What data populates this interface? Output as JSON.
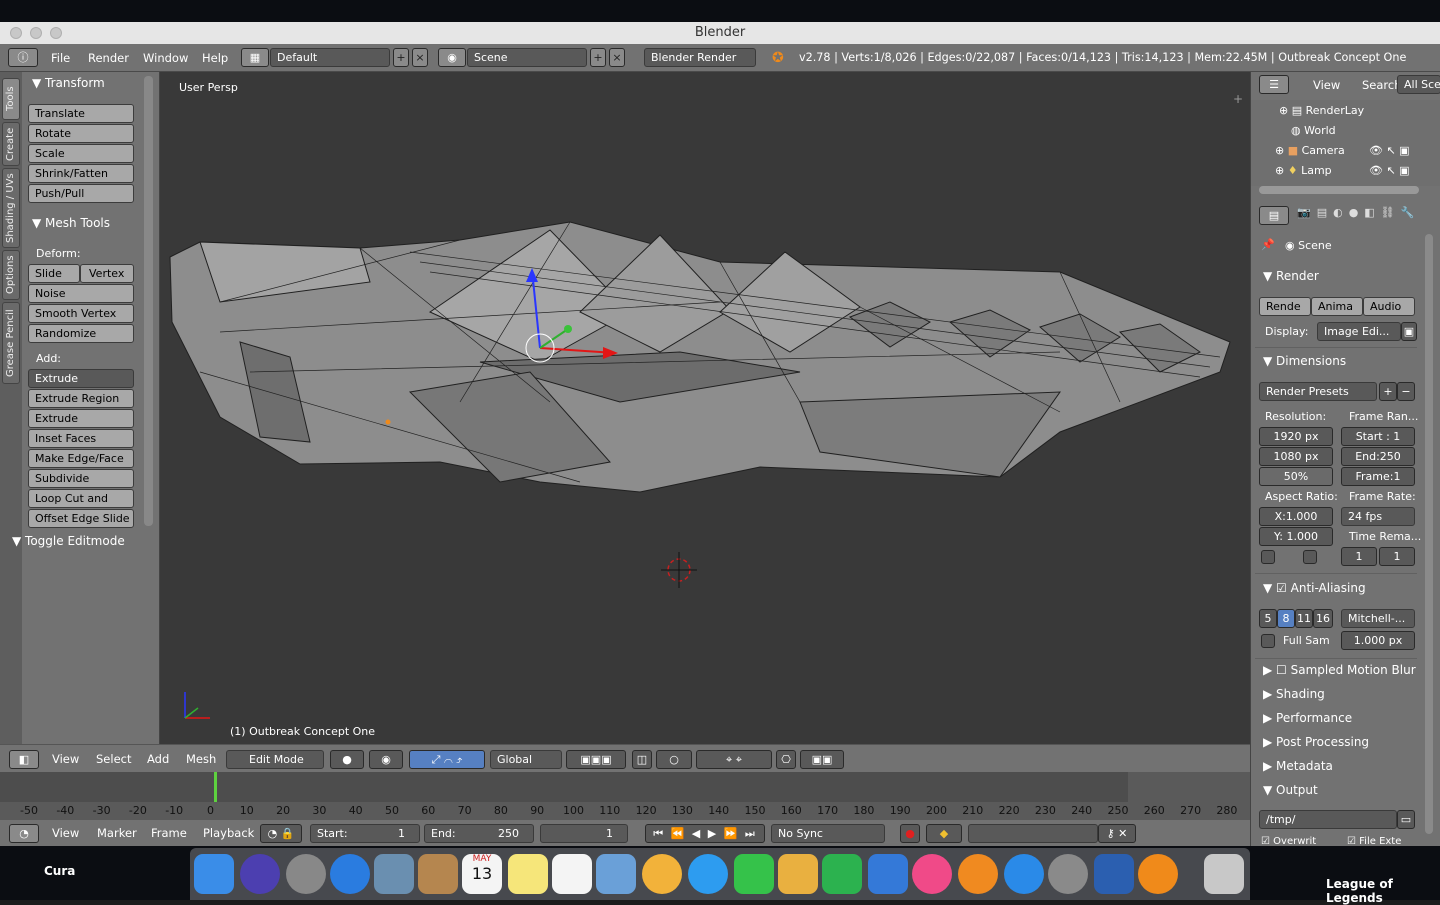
{
  "window": {
    "title": "Blender"
  },
  "menubar": {
    "items": [
      "File",
      "Render",
      "Window",
      "Help"
    ],
    "layout": "Default",
    "scene": "Scene",
    "engine": "Blender Render",
    "stats": "v2.78 | Verts:1/8,026 | Edges:0/22,087 | Faces:0/14,123 | Tris:14,123 | Mem:22.45M | Outbreak Concept One"
  },
  "tabs": [
    "Tools",
    "Create",
    "Shading / UVs",
    "Options",
    "Grease Pencil"
  ],
  "toolshelf": {
    "transform_title": "Transform",
    "transform": [
      "Translate",
      "Rotate",
      "Scale",
      "Shrink/Fatten",
      "Push/Pull"
    ],
    "mesh_tools_title": "Mesh Tools",
    "deform_label": "Deform:",
    "slide_edge": "Slide Ed",
    "vertex": "Vertex",
    "deform": [
      "Noise",
      "Smooth Vertex",
      "Randomize"
    ],
    "add_label": "Add:",
    "extrude": "Extrude",
    "add": [
      "Extrude Region",
      "Extrude Individual",
      "Inset Faces",
      "Make Edge/Face",
      "Subdivide",
      "Loop Cut and Slide",
      "Offset Edge Slide"
    ],
    "toggle": "Toggle Editmode"
  },
  "viewport": {
    "view_label": "User Persp",
    "object_label": "(1) Outbreak Concept One"
  },
  "viewheader": {
    "menus": [
      "View",
      "Select",
      "Add",
      "Mesh"
    ],
    "mode": "Edit Mode",
    "orientation": "Global"
  },
  "timeline": {
    "ticks": [
      "-50",
      "-40",
      "-30",
      "-20",
      "-10",
      "0",
      "10",
      "20",
      "30",
      "40",
      "50",
      "60",
      "70",
      "80",
      "90",
      "100",
      "110",
      "120",
      "130",
      "140",
      "150",
      "160",
      "170",
      "180",
      "190",
      "200",
      "210",
      "220",
      "230",
      "240",
      "250",
      "260",
      "270",
      "280"
    ],
    "menus": [
      "View",
      "Marker",
      "Frame",
      "Playback"
    ],
    "start_label": "Start:",
    "start": "1",
    "end_label": "End:",
    "end": "250",
    "current": "1",
    "sync": "No Sync"
  },
  "outliner": {
    "menus": [
      "View",
      "Search"
    ],
    "filter": "All Scen",
    "items": [
      "RenderLay",
      "World",
      "Camera",
      "Lamp"
    ]
  },
  "properties": {
    "scene": "Scene",
    "render_title": "Render",
    "render_btns": [
      "Rende",
      "Anima",
      "Audio"
    ],
    "display_label": "Display:",
    "display": "Image Edi...",
    "dimensions_title": "Dimensions",
    "presets": "Render Presets",
    "resolution_label": "Resolution:",
    "res_x": "1920 px",
    "res_y": "1080 px",
    "res_pct": "50%",
    "frame_range_label": "Frame Ran...",
    "start": "Start : 1",
    "end": "End:250",
    "frame": "Frame:1",
    "aspect_label": "Aspect Ratio:",
    "aspect_x": "X:1.000",
    "aspect_y": "Y: 1.000",
    "frame_rate_label": "Frame Rate:",
    "fps": "24 fps",
    "time_remap_label": "Time Rema...",
    "remap_old": "1",
    "remap_new": "1",
    "aa_title": "Anti-Aliasing",
    "aa_samples": [
      "5",
      "8",
      "11",
      "16"
    ],
    "aa_filter": "Mitchell-...",
    "full_sample": "Full Sam",
    "filter_size": "1.000 px",
    "collapsed": [
      "Sampled Motion Blur",
      "Shading",
      "Performance",
      "Post Processing",
      "Metadata"
    ],
    "output_title": "Output",
    "output_path": "/tmp/",
    "overwrite": "Overwrit",
    "file_ext": "File Exte"
  },
  "desktop": {
    "left_label": "Cura",
    "right_label": "League of Legends",
    "calendar_month": "MAY",
    "calendar_day": "13"
  },
  "colors": {
    "accent": "#5680c2",
    "panel": "#727272",
    "viewport": "#393939",
    "timeline_frame": "#5ed23f"
  }
}
